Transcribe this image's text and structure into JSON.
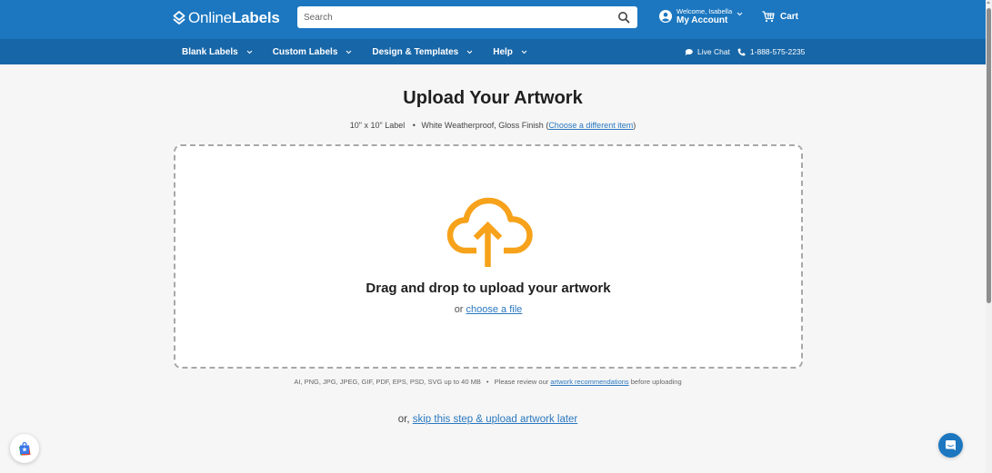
{
  "header": {
    "logo": {
      "part1": "Online",
      "part2": "Labels"
    },
    "search": {
      "placeholder": "Search",
      "value": ""
    },
    "account": {
      "welcome": "Welcome, Isabella",
      "label": "My Account"
    },
    "cart": {
      "label": "Cart"
    }
  },
  "nav": {
    "items": [
      {
        "label": "Blank Labels"
      },
      {
        "label": "Custom Labels"
      },
      {
        "label": "Design & Templates"
      },
      {
        "label": "Help"
      }
    ],
    "live_chat": "Live Chat",
    "phone": "1-888-575-2235"
  },
  "page": {
    "title": "Upload Your Artwork",
    "item_size": "10\" x 10\" Label",
    "item_material": "White Weatherproof, Gloss Finish",
    "paren_open": "(",
    "change_item_link": "Choose a different item",
    "paren_close": ")"
  },
  "dropzone": {
    "title": "Drag and drop to upload your artwork",
    "or_text": "or",
    "choose_file_link": "choose a file"
  },
  "formats": {
    "text": "AI, PNG, JPG, JPEG, GIF, PDF, EPS, PSD, SVG up to 40 MB",
    "review_prefix": "Please review our",
    "recommendations_link": "artwork recommendations",
    "review_suffix": "before uploading"
  },
  "skip": {
    "prefix": "or,",
    "link": "skip this step & upload artwork later"
  },
  "colors": {
    "header_blue": "#1c77c0",
    "subnav_blue": "#1766a7",
    "accent_orange": "#f7a21b",
    "link_blue": "#2a78c0"
  }
}
